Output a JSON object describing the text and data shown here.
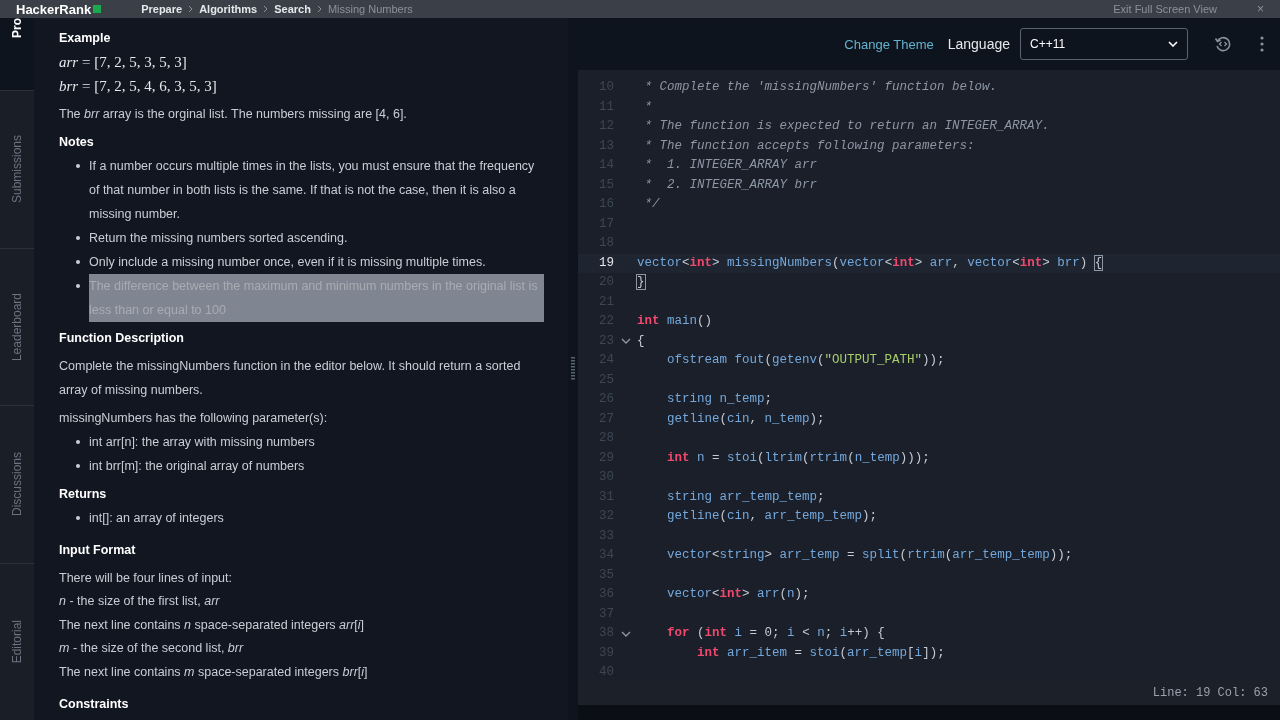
{
  "top_bar": {
    "logo": "HackerRank",
    "breadcrumb": [
      "Prepare",
      "Algorithms",
      "Search",
      "Missing Numbers"
    ],
    "exit_link": "Exit Full Screen View",
    "close": "×"
  },
  "side_tabs": [
    {
      "label": "Pro",
      "selected": true
    },
    {
      "label": "Submissions",
      "selected": false
    },
    {
      "label": "Leaderboard",
      "selected": false
    },
    {
      "label": "Discussions",
      "selected": false
    },
    {
      "label": "Editorial",
      "selected": false
    }
  ],
  "problem": [
    {
      "kind": "heading",
      "text": "Example"
    },
    {
      "kind": "math",
      "text": "*arr* = [7, 2, 5, 3, 5, 3]"
    },
    {
      "kind": "math",
      "text": "*brr* = [7, 2, 5, 4, 6, 3, 5, 3]"
    },
    {
      "kind": "para",
      "text": "The *brr* array is the orginal list. The numbers missing are [4, 6]."
    },
    {
      "kind": "heading",
      "text": "Notes"
    },
    {
      "kind": "bullets",
      "items": [
        {
          "text": "If a number occurs multiple times in the lists, you must ensure that the frequency of that number in both lists is the same. If that is not the case, then it is also a missing number.",
          "highlighted": false
        },
        {
          "text": "Return the missing numbers sorted ascending.",
          "highlighted": false
        },
        {
          "text": "Only include a missing number once, even if it is missing multiple times.",
          "highlighted": false
        },
        {
          "text": "The difference between the maximum and minimum numbers in the original list is less than or equal to 100",
          "highlighted": true
        }
      ]
    },
    {
      "kind": "heading",
      "text": "Function Description"
    },
    {
      "kind": "para",
      "text": "Complete the missingNumbers function in the editor below. It should return a sorted array of missing numbers."
    },
    {
      "kind": "para",
      "text": "missingNumbers has the following parameter(s):"
    },
    {
      "kind": "bullets",
      "items": [
        {
          "text": "int arr[n]: the array with missing numbers",
          "highlighted": false
        },
        {
          "text": "int brr[m]: the original array of numbers",
          "highlighted": false
        }
      ]
    },
    {
      "kind": "heading",
      "text": "Returns"
    },
    {
      "kind": "bullets",
      "items": [
        {
          "text": "int[]: an array of integers",
          "highlighted": false
        }
      ]
    },
    {
      "kind": "heading",
      "text": "Input Format"
    },
    {
      "kind": "para",
      "text": "There will be four lines of input:"
    },
    {
      "kind": "line",
      "text": "*n* - the size of the first list, *arr*"
    },
    {
      "kind": "line",
      "text": "The next line contains *n* space-separated integers *arr*[*i*]"
    },
    {
      "kind": "line",
      "text": "*m* - the size of the second list, *brr*"
    },
    {
      "kind": "line",
      "text": "The next line contains *m* space-separated integers *brr*[*i*]"
    },
    {
      "kind": "heading",
      "text": "Constraints"
    }
  ],
  "toolbar": {
    "change_theme": "Change Theme",
    "language_label": "Language",
    "language": "C++11"
  },
  "code": [
    {
      "number": "10",
      "selected": false,
      "fold": false,
      "tokens": [
        {
          "kind": "c",
          "text": " * Complete the 'missingNumbers' function below."
        }
      ]
    },
    {
      "number": "11",
      "selected": false,
      "fold": false,
      "tokens": [
        {
          "kind": "c",
          "text": " *"
        }
      ]
    },
    {
      "number": "12",
      "selected": false,
      "fold": false,
      "tokens": [
        {
          "kind": "c",
          "text": " * The function is expected to return an INTEGER_ARRAY."
        }
      ]
    },
    {
      "number": "13",
      "selected": false,
      "fold": false,
      "tokens": [
        {
          "kind": "c",
          "text": " * The function accepts following parameters:"
        }
      ]
    },
    {
      "number": "14",
      "selected": false,
      "fold": false,
      "tokens": [
        {
          "kind": "c",
          "text": " *  1. INTEGER_ARRAY arr"
        }
      ]
    },
    {
      "number": "15",
      "selected": false,
      "fold": false,
      "tokens": [
        {
          "kind": "c",
          "text": " *  2. INTEGER_ARRAY brr"
        }
      ]
    },
    {
      "number": "16",
      "selected": false,
      "fold": false,
      "tokens": [
        {
          "kind": "c",
          "text": " */"
        }
      ]
    },
    {
      "number": "17",
      "selected": false,
      "fold": false
    },
    {
      "number": "18",
      "selected": false,
      "fold": false
    },
    {
      "number": "19",
      "selected": true,
      "fold": false,
      "tokens": [
        {
          "kind": "t",
          "text": "vector"
        },
        {
          "kind": "p",
          "text": "<"
        },
        {
          "kind": "k",
          "text": "int"
        },
        {
          "kind": "p",
          "text": "> "
        },
        {
          "kind": "t",
          "text": "missingNumbers"
        },
        {
          "kind": "p",
          "text": "("
        },
        {
          "kind": "t",
          "text": "vector"
        },
        {
          "kind": "p",
          "text": "<"
        },
        {
          "kind": "k",
          "text": "int"
        },
        {
          "kind": "p",
          "text": "> "
        },
        {
          "kind": "t",
          "text": "arr"
        },
        {
          "kind": "p",
          "text": ", "
        },
        {
          "kind": "t",
          "text": "vector"
        },
        {
          "kind": "p",
          "text": "<"
        },
        {
          "kind": "k",
          "text": "int"
        },
        {
          "kind": "p",
          "text": "> "
        },
        {
          "kind": "t",
          "text": "brr"
        },
        {
          "kind": "p",
          "text": ") "
        },
        {
          "kind": "m",
          "text": "{"
        }
      ]
    },
    {
      "number": "20",
      "selected": false,
      "fold": false,
      "tokens": [
        {
          "kind": "m",
          "text": "}"
        }
      ]
    },
    {
      "number": "21",
      "selected": false,
      "fold": false
    },
    {
      "number": "22",
      "selected": false,
      "fold": false,
      "tokens": [
        {
          "kind": "k",
          "text": "int"
        },
        {
          "kind": "t",
          "text": " main"
        },
        {
          "kind": "p",
          "text": "()"
        }
      ]
    },
    {
      "number": "23",
      "selected": false,
      "fold": true,
      "tokens": [
        {
          "kind": "p",
          "text": "{"
        }
      ]
    },
    {
      "number": "24",
      "selected": false,
      "fold": false,
      "tokens": [
        {
          "kind": "t",
          "text": "    ofstream fout"
        },
        {
          "kind": "p",
          "text": "("
        },
        {
          "kind": "t",
          "text": "getenv"
        },
        {
          "kind": "p",
          "text": "("
        },
        {
          "kind": "s",
          "text": "\"OUTPUT_PATH\""
        },
        {
          "kind": "p",
          "text": "));"
        }
      ]
    },
    {
      "number": "25",
      "selected": false,
      "fold": false
    },
    {
      "number": "26",
      "selected": false,
      "fold": false,
      "tokens": [
        {
          "kind": "t",
          "text": "    string n_temp"
        },
        {
          "kind": "p",
          "text": ";"
        }
      ]
    },
    {
      "number": "27",
      "selected": false,
      "fold": false,
      "tokens": [
        {
          "kind": "t",
          "text": "    getline"
        },
        {
          "kind": "p",
          "text": "("
        },
        {
          "kind": "t",
          "text": "cin"
        },
        {
          "kind": "p",
          "text": ", "
        },
        {
          "kind": "t",
          "text": "n_temp"
        },
        {
          "kind": "p",
          "text": ");"
        }
      ]
    },
    {
      "number": "28",
      "selected": false,
      "fold": false
    },
    {
      "number": "29",
      "selected": false,
      "fold": false,
      "tokens": [
        {
          "kind": "k",
          "text": "    int"
        },
        {
          "kind": "t",
          "text": " n"
        },
        {
          "kind": "p",
          "text": " = "
        },
        {
          "kind": "t",
          "text": "stoi"
        },
        {
          "kind": "p",
          "text": "("
        },
        {
          "kind": "t",
          "text": "ltrim"
        },
        {
          "kind": "p",
          "text": "("
        },
        {
          "kind": "t",
          "text": "rtrim"
        },
        {
          "kind": "p",
          "text": "("
        },
        {
          "kind": "t",
          "text": "n_temp"
        },
        {
          "kind": "p",
          "text": ")));"
        }
      ]
    },
    {
      "number": "30",
      "selected": false,
      "fold": false
    },
    {
      "number": "31",
      "selected": false,
      "fold": false,
      "tokens": [
        {
          "kind": "t",
          "text": "    string arr_temp_temp"
        },
        {
          "kind": "p",
          "text": ";"
        }
      ]
    },
    {
      "number": "32",
      "selected": false,
      "fold": false,
      "tokens": [
        {
          "kind": "t",
          "text": "    getline"
        },
        {
          "kind": "p",
          "text": "("
        },
        {
          "kind": "t",
          "text": "cin"
        },
        {
          "kind": "p",
          "text": ", "
        },
        {
          "kind": "t",
          "text": "arr_temp_temp"
        },
        {
          "kind": "p",
          "text": ");"
        }
      ]
    },
    {
      "number": "33",
      "selected": false,
      "fold": false
    },
    {
      "number": "34",
      "selected": false,
      "fold": false,
      "tokens": [
        {
          "kind": "t",
          "text": "    vector"
        },
        {
          "kind": "p",
          "text": "<"
        },
        {
          "kind": "t",
          "text": "string"
        },
        {
          "kind": "p",
          "text": "> "
        },
        {
          "kind": "t",
          "text": "arr_temp"
        },
        {
          "kind": "p",
          "text": " = "
        },
        {
          "kind": "t",
          "text": "split"
        },
        {
          "kind": "p",
          "text": "("
        },
        {
          "kind": "t",
          "text": "rtrim"
        },
        {
          "kind": "p",
          "text": "("
        },
        {
          "kind": "t",
          "text": "arr_temp_temp"
        },
        {
          "kind": "p",
          "text": "));"
        }
      ]
    },
    {
      "number": "35",
      "selected": false,
      "fold": false
    },
    {
      "number": "36",
      "selected": false,
      "fold": false,
      "tokens": [
        {
          "kind": "t",
          "text": "    vector"
        },
        {
          "kind": "p",
          "text": "<"
        },
        {
          "kind": "k",
          "text": "int"
        },
        {
          "kind": "p",
          "text": "> "
        },
        {
          "kind": "t",
          "text": "arr"
        },
        {
          "kind": "p",
          "text": "("
        },
        {
          "kind": "t",
          "text": "n"
        },
        {
          "kind": "p",
          "text": ");"
        }
      ]
    },
    {
      "number": "37",
      "selected": false,
      "fold": false
    },
    {
      "number": "38",
      "selected": false,
      "fold": true,
      "tokens": [
        {
          "kind": "k",
          "text": "    for"
        },
        {
          "kind": "p",
          "text": " ("
        },
        {
          "kind": "k",
          "text": "int"
        },
        {
          "kind": "t",
          "text": " i"
        },
        {
          "kind": "p",
          "text": " = "
        },
        {
          "kind": "n",
          "text": "0"
        },
        {
          "kind": "p",
          "text": "; "
        },
        {
          "kind": "t",
          "text": "i"
        },
        {
          "kind": "p",
          "text": " < "
        },
        {
          "kind": "t",
          "text": "n"
        },
        {
          "kind": "p",
          "text": "; "
        },
        {
          "kind": "t",
          "text": "i"
        },
        {
          "kind": "p",
          "text": "++) {"
        }
      ]
    },
    {
      "number": "39",
      "selected": false,
      "fold": false,
      "tokens": [
        {
          "kind": "k",
          "text": "        int"
        },
        {
          "kind": "t",
          "text": " arr_item"
        },
        {
          "kind": "p",
          "text": " = "
        },
        {
          "kind": "t",
          "text": "stoi"
        },
        {
          "kind": "p",
          "text": "("
        },
        {
          "kind": "t",
          "text": "arr_temp"
        },
        {
          "kind": "p",
          "text": "["
        },
        {
          "kind": "t",
          "text": "i"
        },
        {
          "kind": "p",
          "text": "]);"
        }
      ]
    },
    {
      "number": "40",
      "selected": false,
      "fold": false
    }
  ],
  "status_bar": {
    "position": "Line: 19 Col: 63"
  }
}
